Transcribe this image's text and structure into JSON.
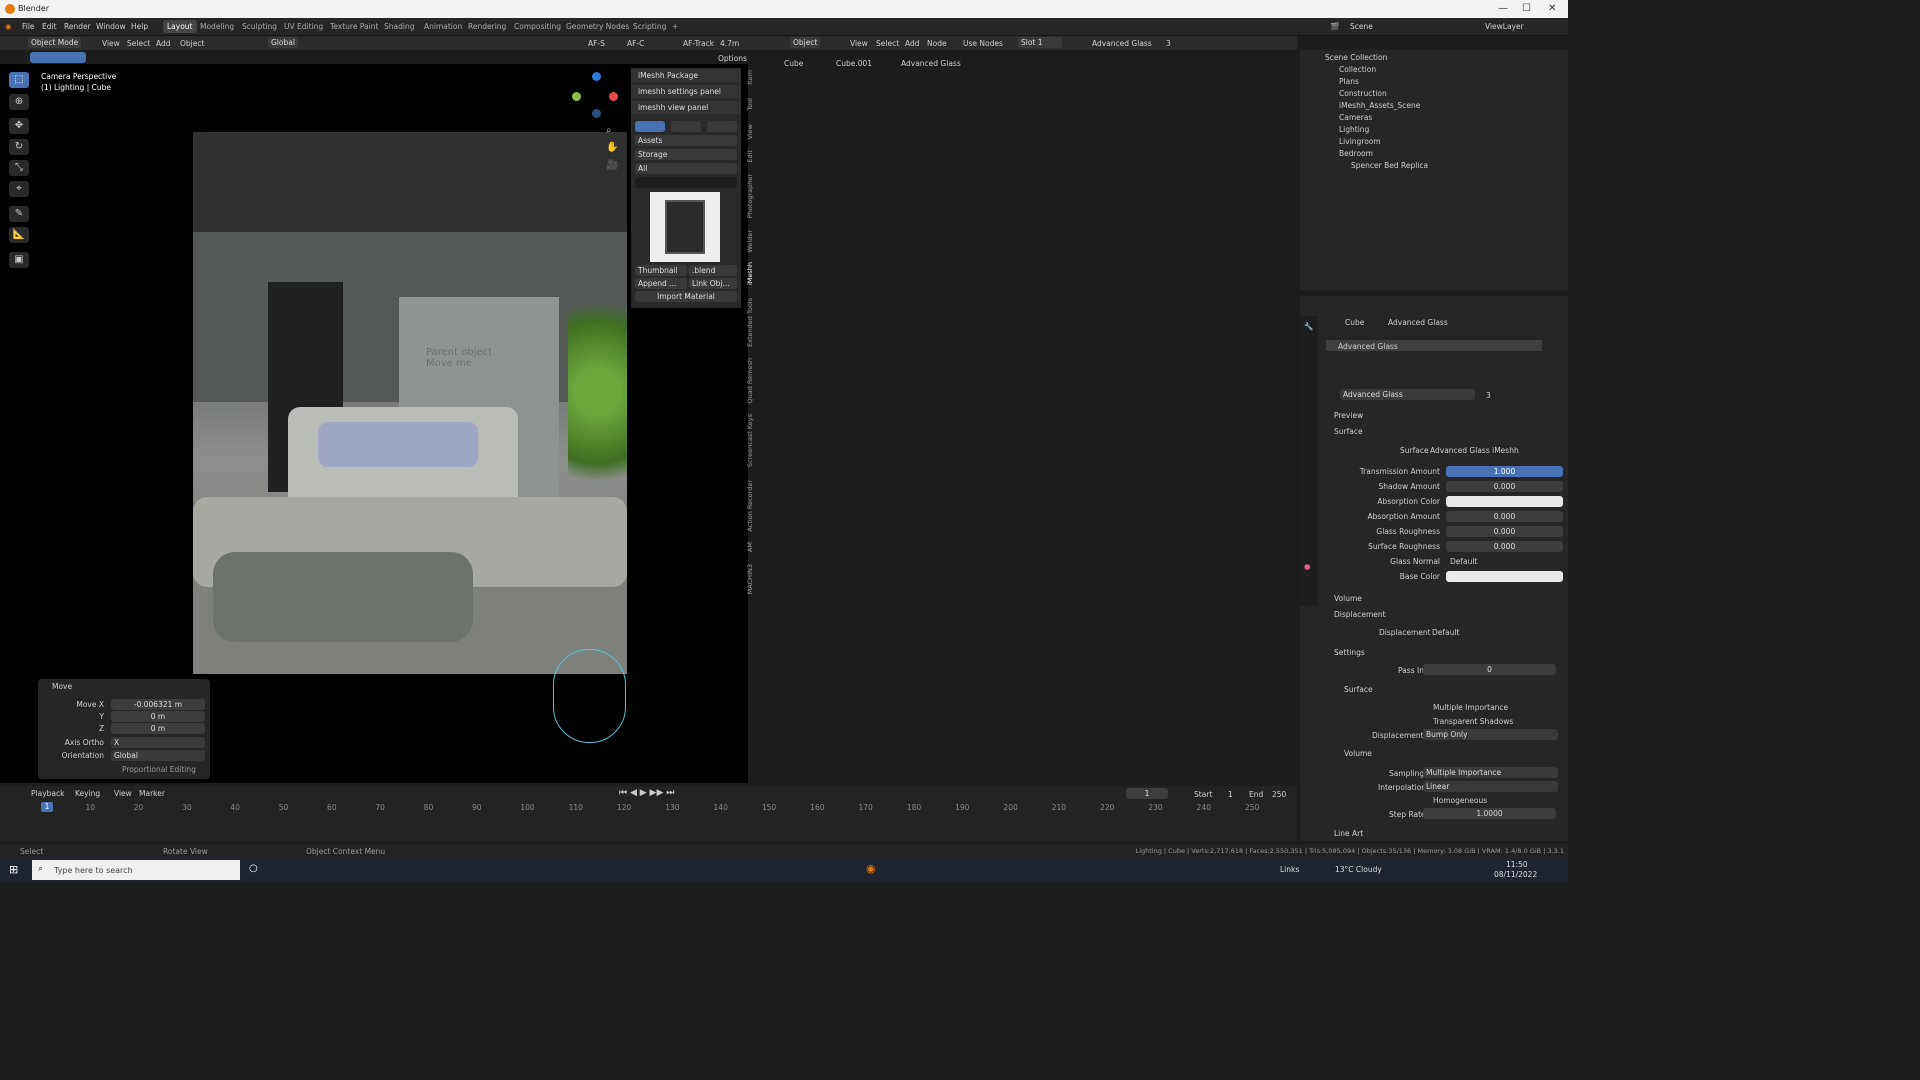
{
  "window": {
    "title": "Blender"
  },
  "menu": [
    "File",
    "Edit",
    "Render",
    "Window",
    "Help"
  ],
  "workspaces": [
    "Layout",
    "Modeling",
    "Sculpting",
    "UV Editing",
    "Texture Paint",
    "Shading",
    "Animation",
    "Rendering",
    "Compositing",
    "Geometry Nodes",
    "Scripting"
  ],
  "active_workspace": "Layout",
  "viewport": {
    "mode": "Object Mode",
    "menus": [
      "View",
      "Select",
      "Add",
      "Object"
    ],
    "transform": "Global",
    "snap": "4.7m",
    "af_track": "AF-Track",
    "af_s": "AF-S",
    "af_c": "AF-C",
    "options": "Options",
    "overlay_title": "Camera Perspective",
    "overlay_sub": "(1) Lighting | Cube",
    "scene_text": "Parent object\nMove me"
  },
  "npanel": {
    "sections": [
      "iMeshh Package",
      "imeshh settings panel",
      "imeshh view panel"
    ],
    "dd1": "Assets",
    "dd2": "Storage",
    "dd3": "All",
    "thumb_btn": "Thumbnail",
    "blend_btn": ".blend",
    "append_btn": "Append ...",
    "link_btn": "Link Obj...",
    "import_btn": "Import Material"
  },
  "side_tabs": [
    "Item",
    "Tool",
    "View",
    "Edit",
    "Photographer",
    "Welder",
    "iMeshh",
    "Extended Tools",
    "Quad Remesh",
    "Screencast Keys",
    "Action Recorder",
    "AM",
    "MACHIN3"
  ],
  "move": {
    "title": "Move",
    "move_x_label": "Move X",
    "move_x": "-0.006321 m",
    "y_label": "Y",
    "y": "0 m",
    "z_label": "Z",
    "z": "0 m",
    "axis_ortho_label": "Axis Ortho",
    "axis_ortho": "X",
    "orientation_label": "Orientation",
    "orientation": "Global",
    "proportional": "Proportional Editing"
  },
  "node_editor": {
    "object": "Object",
    "menus": [
      "View",
      "Select",
      "Add",
      "Node"
    ],
    "use_nodes": "Use Nodes",
    "slot": "Slot 1",
    "material": "Advanced Glass",
    "users": "3",
    "breadcrumb": [
      "Cube",
      "Cube.001",
      "Advanced Glass"
    ]
  },
  "outliner": {
    "scene": "Scene",
    "view_layer": "ViewLayer",
    "rows": [
      "Scene Collection",
      "Collection",
      "Plans",
      "Construction",
      "iMeshh_Assets_Scene",
      "Cameras",
      "Lighting",
      "Livingroom",
      "Bedroom",
      "Spencer Bed Replica"
    ]
  },
  "properties": {
    "breadcrumb": [
      "Cube",
      "Advanced Glass"
    ],
    "slot_name": "Advanced Glass",
    "material": "Advanced Glass",
    "users": "3",
    "preview": "Preview",
    "surface_header": "Surface",
    "surface_label": "Surface",
    "surface_value": "Advanced Glass iMeshh",
    "rows": [
      {
        "label": "Transmission Amount",
        "value": "1.000"
      },
      {
        "label": "Shadow Amount",
        "value": "0.000"
      },
      {
        "label": "Absorption Color",
        "value": ""
      },
      {
        "label": "Absorption Amount",
        "value": "0.000"
      },
      {
        "label": "Glass Roughness",
        "value": "0.000"
      },
      {
        "label": "Surface Roughness",
        "value": "0.000"
      },
      {
        "label": "Glass Normal",
        "value": "Default"
      },
      {
        "label": "Base Color",
        "value": ""
      }
    ],
    "volume": "Volume",
    "displacement_header": "Displacement",
    "displacement_label": "Displacement",
    "displacement_value": "Default",
    "settings": "Settings",
    "pass_index_label": "Pass Index",
    "pass_index": "0",
    "surface_sub": "Surface",
    "multiple_importance": "Multiple Importance",
    "transparent_shadows": "Transparent Shadows",
    "disp_label": "Displacement",
    "disp_value": "Bump Only",
    "volume_sub": "Volume",
    "sampling_label": "Sampling",
    "sampling": "Multiple Importance",
    "interp_label": "Interpolation",
    "interp": "Linear",
    "homogeneous": "Homogeneous",
    "step_label": "Step Rate",
    "step": "1.0000",
    "line_art": "Line Art"
  },
  "timeline": {
    "menus": [
      "Playback",
      "Keying",
      "View",
      "Marker"
    ],
    "frame": "1",
    "start_label": "Start",
    "start": "1",
    "end_label": "End",
    "end": "250",
    "ticks": [
      "1",
      "10",
      "20",
      "30",
      "40",
      "50",
      "60",
      "70",
      "80",
      "90",
      "100",
      "110",
      "120",
      "130",
      "140",
      "150",
      "160",
      "170",
      "180",
      "190",
      "200",
      "210",
      "220",
      "230",
      "240",
      "250"
    ],
    "current": "1"
  },
  "status": {
    "select": "Select",
    "rotate": "Rotate View",
    "context": "Object Context Menu",
    "stats": "Lighting | Cube | Verts:2,717,618 | Faces:2,550,351 | Tris:5,085,094 | Objects:35/136 | Memory: 3.08 GiB | VRAM: 1.4/8.0 GiB | 3.3.1"
  },
  "taskbar": {
    "search_placeholder": "Type here to search",
    "links": "Links",
    "weather": "13°C  Cloudy",
    "time": "11:50",
    "date": "08/11/2022"
  }
}
